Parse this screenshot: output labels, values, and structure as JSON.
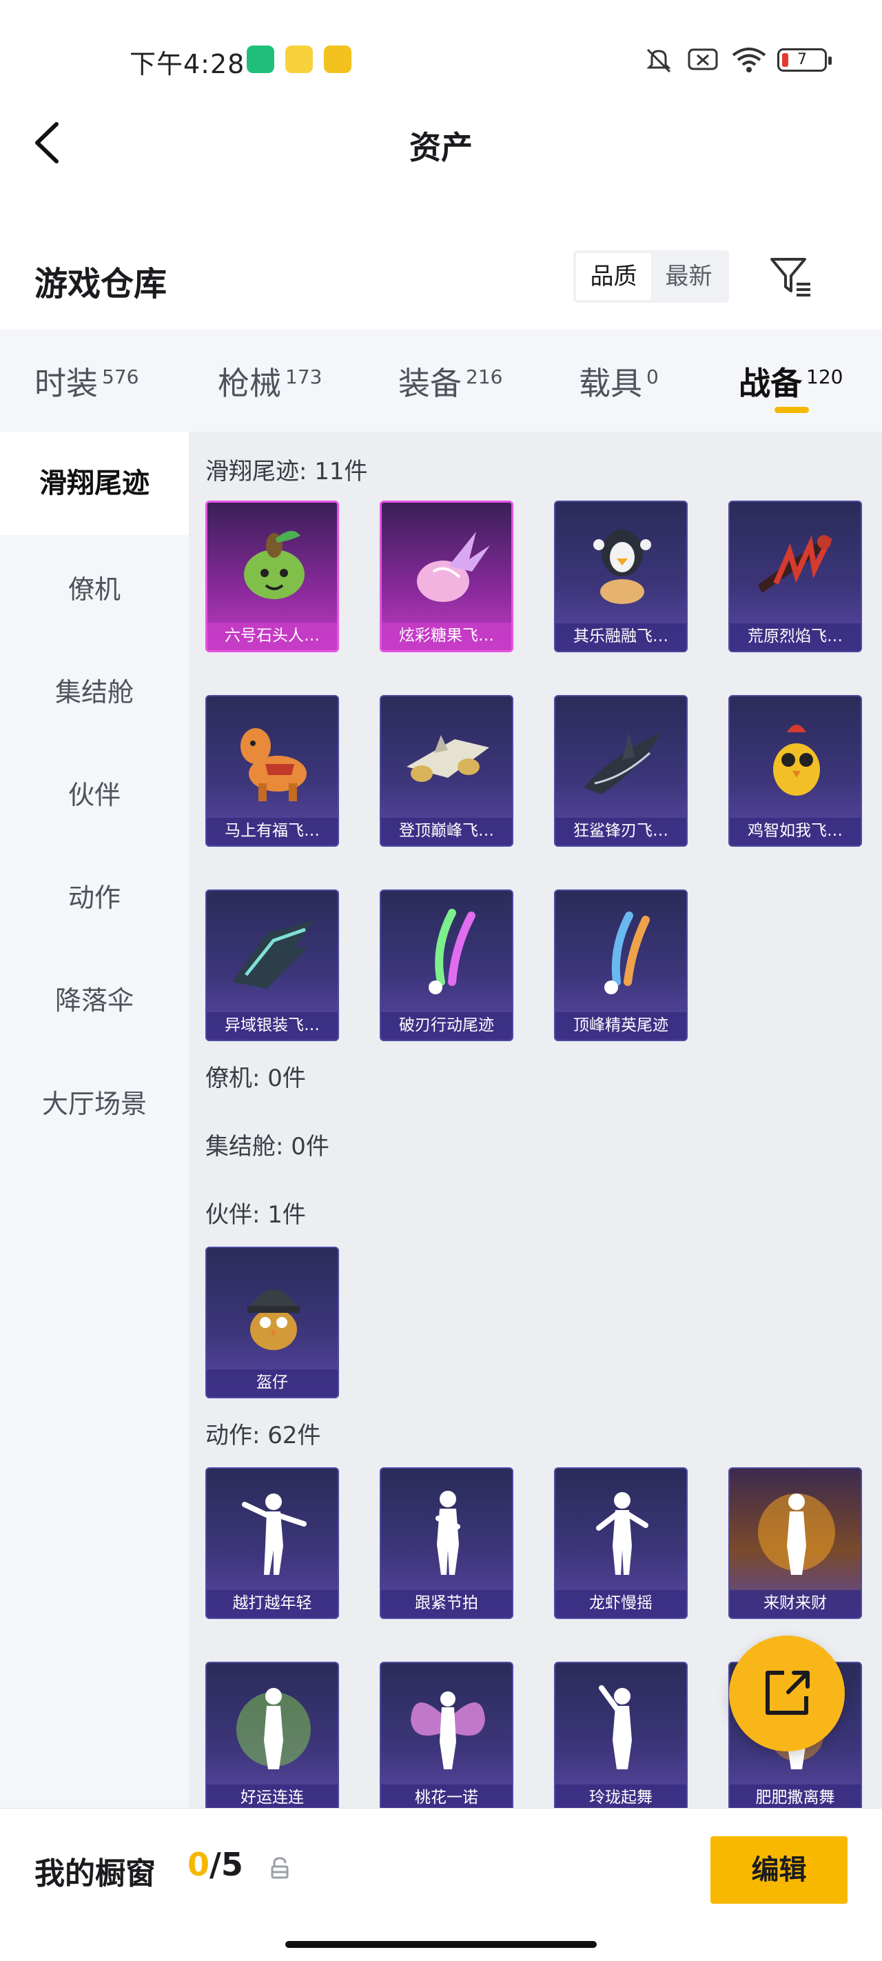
{
  "status": {
    "time": "下午4:28",
    "battery": "7"
  },
  "header": {
    "title": "资产"
  },
  "warehouse": {
    "title": "游戏仓库",
    "sort_options": [
      "品质",
      "最新"
    ]
  },
  "categories": [
    {
      "label": "时装",
      "count": "576"
    },
    {
      "label": "枪械",
      "count": "173"
    },
    {
      "label": "装备",
      "count": "216"
    },
    {
      "label": "载具",
      "count": "0"
    },
    {
      "label": "战备",
      "count": "120"
    }
  ],
  "sidebar": [
    "滑翔尾迹",
    "僚机",
    "集结舱",
    "伙伴",
    "动作",
    "降落伞",
    "大厅场景"
  ],
  "sections": {
    "glide": {
      "title": "滑翔尾迹: 11件",
      "items": [
        "六号石头人…",
        "炫彩糖果飞…",
        "其乐融融飞…",
        "荒原烈焰飞…",
        "马上有福飞…",
        "登顶巅峰飞…",
        "狂鲨锋刃飞…",
        "鸡智如我飞…",
        "异域银装飞…",
        "破刃行动尾迹",
        "顶峰精英尾迹"
      ]
    },
    "wingman": {
      "title": "僚机: 0件"
    },
    "capsule": {
      "title": "集结舱: 0件"
    },
    "partner": {
      "title": "伙伴: 1件",
      "items": [
        "盔仔"
      ]
    },
    "emote": {
      "title": "动作: 62件",
      "items": [
        "越打越年轻",
        "跟紧节拍",
        "龙虾慢摇",
        "来财来财",
        "好运连连",
        "桃花一诺",
        "玲珑起舞",
        "肥肥撒离舞"
      ]
    }
  },
  "showcase": {
    "label": "我的橱窗",
    "current": "0",
    "total": "/5",
    "edit": "编辑"
  },
  "colors": {
    "accent": "#f5b800",
    "card": "#3c3579",
    "legendary": "#c43fc0"
  }
}
